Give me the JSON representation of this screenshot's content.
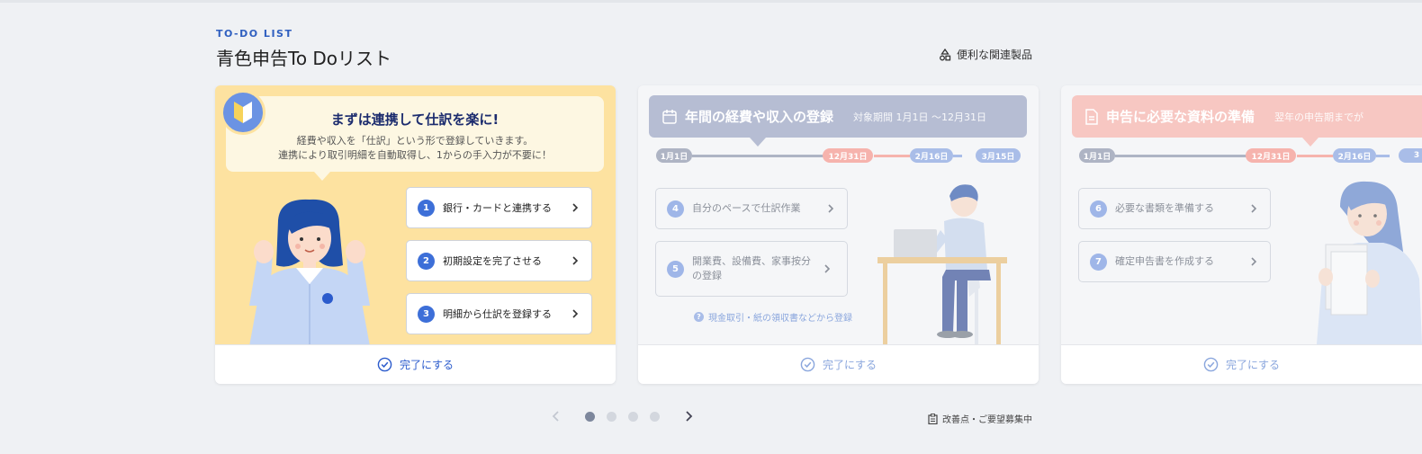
{
  "header": {
    "eyebrow": "TO-DO LIST",
    "title": "青色申告To Doリスト",
    "related_products": "便利な関連製品"
  },
  "card1": {
    "title": "まずは連携して仕訳を楽に!",
    "desc_line1": "経費や収入を「仕訳」という形で登録していきます。",
    "desc_line2": "連携により取引明細を自動取得し、1からの手入力が不要に！",
    "steps": [
      {
        "num": "1",
        "label": "銀行・カードと連携する"
      },
      {
        "num": "2",
        "label": "初期設定を完了させる"
      },
      {
        "num": "3",
        "label": "明細から仕訳を登録する"
      }
    ],
    "complete": "完了にする"
  },
  "card2": {
    "title": "年間の経費や収入の登録",
    "period": "対象期間 1月1日 〜12月31日",
    "dates": [
      "1月1日",
      "12月31日",
      "2月16日",
      "3月15日"
    ],
    "steps": [
      {
        "num": "4",
        "label": "自分のペースで仕訳作業"
      },
      {
        "num": "5",
        "label": "開業費、設備費、家事按分の登録"
      }
    ],
    "note": "現金取引・紙の領収書などから登録",
    "complete": "完了にする"
  },
  "card3": {
    "title": "申告に必要な資料の準備",
    "period": "翌年の申告期までが",
    "dates": [
      "1月1日",
      "12月31日",
      "2月16日",
      "3"
    ],
    "steps": [
      {
        "num": "6",
        "label": "必要な書類を準備する"
      },
      {
        "num": "7",
        "label": "確定申告書を作成する"
      }
    ],
    "complete": "完了にする"
  },
  "pager": {
    "pages": 4,
    "active": 1
  },
  "feedback": "改善点・ご要望募集中",
  "colors": {
    "accent": "#3d6fd8",
    "card1_bg": "#fde2a0",
    "card2_banner": "#b6bdd3",
    "card3_banner": "#f7c7c2",
    "timeline_gray": "#aeb4c4",
    "timeline_pink": "#f6b3ad",
    "timeline_blue": "#a9bde8"
  }
}
